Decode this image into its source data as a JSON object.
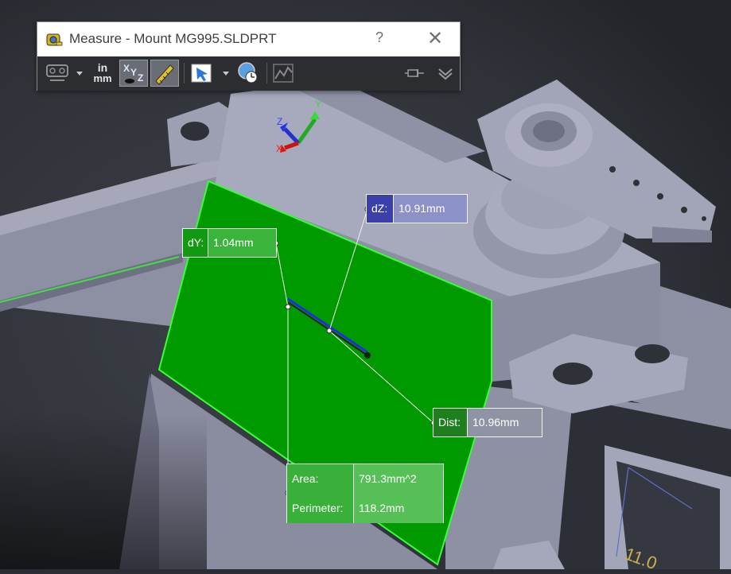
{
  "dialog": {
    "title": "Measure - Mount MG995.SLDPRT",
    "help_label": "?",
    "close_label": "✕",
    "toolbar": {
      "arc_circle_icon": "arc-circle-measure-icon",
      "units_top": "in",
      "units_bottom": "mm",
      "xyz_icon": "xyz-measure-icon",
      "point_to_point_icon": "point-to-point-icon",
      "projection_icon": "projection-icon",
      "history_icon": "measurement-history-icon",
      "sensor_icon": "create-sensor-icon",
      "pin_icon": "pin-icon",
      "expand_icon": "expand-icon"
    }
  },
  "callouts": {
    "dy": {
      "label": "dY:",
      "value": "1.04mm"
    },
    "dz": {
      "label": "dZ:",
      "value": "10.91mm"
    },
    "dist": {
      "label": "Dist:",
      "value": "10.96mm"
    },
    "area": {
      "label": "Area:",
      "value": "791.3mm^2"
    },
    "perimeter": {
      "label": "Perimeter:",
      "value": "118.2mm"
    }
  },
  "triad": {
    "x": "X",
    "y": "Y",
    "z": "Z"
  },
  "corner_label": "11.0",
  "colors": {
    "selected_face": "#009900",
    "dialog_toolbar": "#2b2d31",
    "model": "#9a9cb0",
    "background": "#2a2d33",
    "dz_label": "#3a3faa"
  }
}
